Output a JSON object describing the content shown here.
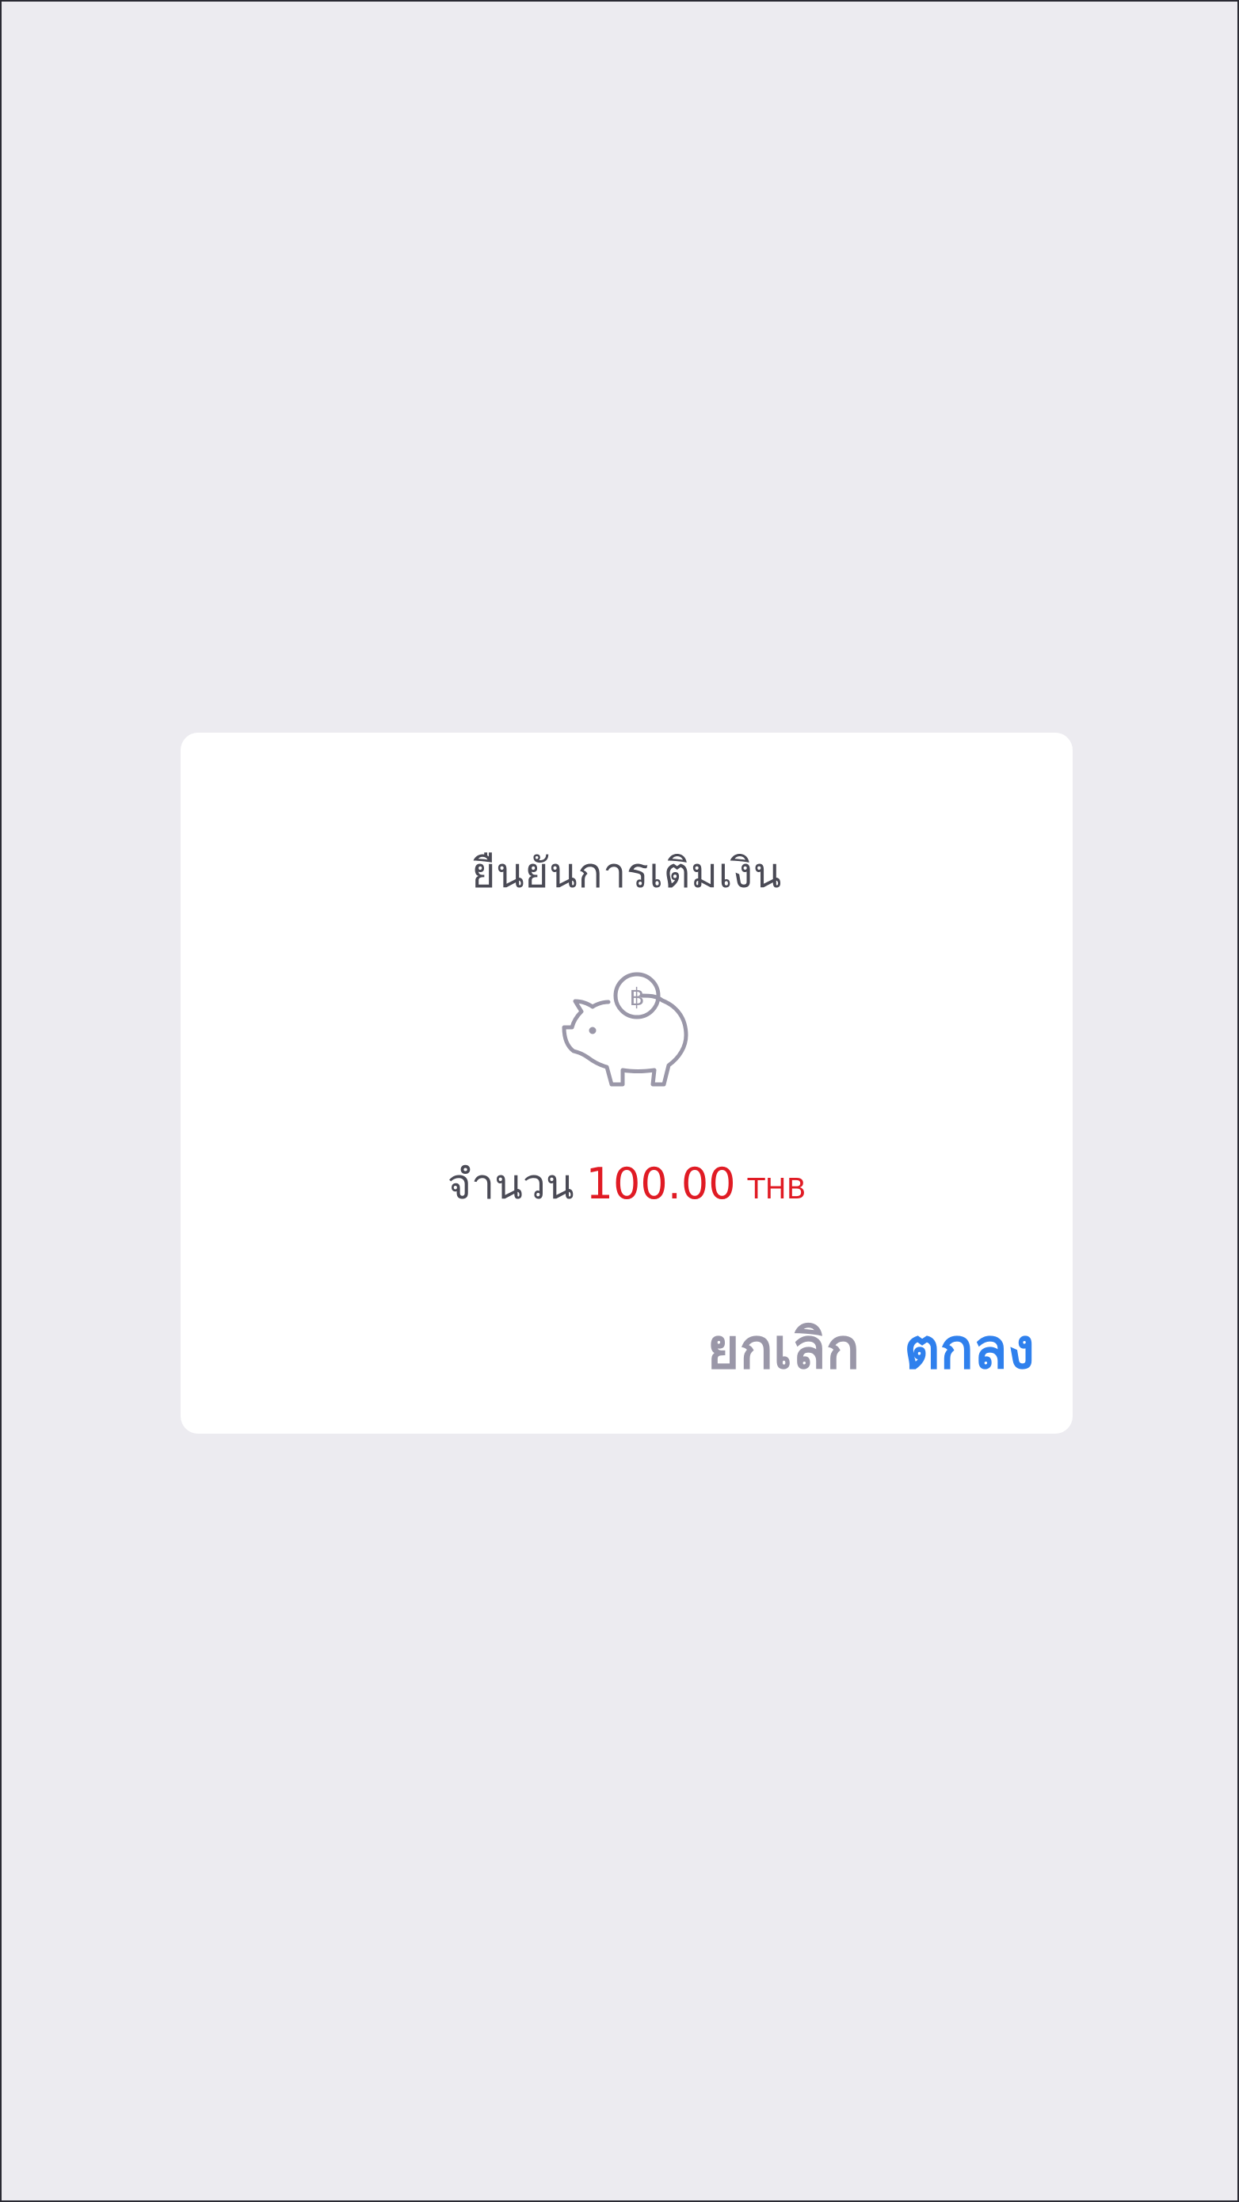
{
  "dialog": {
    "title": "ยืนยันการเติมเงิน",
    "icon": "piggy-bank-baht-icon",
    "amount_label": "จำนวน",
    "amount_value": "100.00",
    "currency": "THB",
    "cancel_label": "ยกเลิก",
    "ok_label": "ตกลง"
  },
  "colors": {
    "background": "#ECEBF0",
    "card": "#FFFFFF",
    "accent_red": "#E01B24",
    "accent_blue": "#2F80ED",
    "muted": "#9A97A8",
    "icon_stroke": "#9A97A8"
  }
}
